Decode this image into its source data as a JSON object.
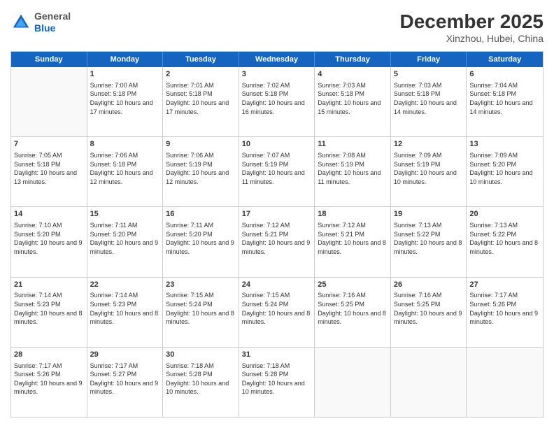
{
  "header": {
    "logo": {
      "general": "General",
      "blue": "Blue"
    },
    "title": "December 2025",
    "location": "Xinzhou, Hubei, China"
  },
  "weekdays": [
    "Sunday",
    "Monday",
    "Tuesday",
    "Wednesday",
    "Thursday",
    "Friday",
    "Saturday"
  ],
  "weeks": [
    [
      {
        "day": "",
        "empty": true
      },
      {
        "day": "1",
        "sunrise": "Sunrise: 7:00 AM",
        "sunset": "Sunset: 5:18 PM",
        "daylight": "Daylight: 10 hours and 17 minutes."
      },
      {
        "day": "2",
        "sunrise": "Sunrise: 7:01 AM",
        "sunset": "Sunset: 5:18 PM",
        "daylight": "Daylight: 10 hours and 17 minutes."
      },
      {
        "day": "3",
        "sunrise": "Sunrise: 7:02 AM",
        "sunset": "Sunset: 5:18 PM",
        "daylight": "Daylight: 10 hours and 16 minutes."
      },
      {
        "day": "4",
        "sunrise": "Sunrise: 7:03 AM",
        "sunset": "Sunset: 5:18 PM",
        "daylight": "Daylight: 10 hours and 15 minutes."
      },
      {
        "day": "5",
        "sunrise": "Sunrise: 7:03 AM",
        "sunset": "Sunset: 5:18 PM",
        "daylight": "Daylight: 10 hours and 14 minutes."
      },
      {
        "day": "6",
        "sunrise": "Sunrise: 7:04 AM",
        "sunset": "Sunset: 5:18 PM",
        "daylight": "Daylight: 10 hours and 14 minutes."
      }
    ],
    [
      {
        "day": "7",
        "sunrise": "Sunrise: 7:05 AM",
        "sunset": "Sunset: 5:18 PM",
        "daylight": "Daylight: 10 hours and 13 minutes."
      },
      {
        "day": "8",
        "sunrise": "Sunrise: 7:06 AM",
        "sunset": "Sunset: 5:18 PM",
        "daylight": "Daylight: 10 hours and 12 minutes."
      },
      {
        "day": "9",
        "sunrise": "Sunrise: 7:06 AM",
        "sunset": "Sunset: 5:19 PM",
        "daylight": "Daylight: 10 hours and 12 minutes."
      },
      {
        "day": "10",
        "sunrise": "Sunrise: 7:07 AM",
        "sunset": "Sunset: 5:19 PM",
        "daylight": "Daylight: 10 hours and 11 minutes."
      },
      {
        "day": "11",
        "sunrise": "Sunrise: 7:08 AM",
        "sunset": "Sunset: 5:19 PM",
        "daylight": "Daylight: 10 hours and 11 minutes."
      },
      {
        "day": "12",
        "sunrise": "Sunrise: 7:09 AM",
        "sunset": "Sunset: 5:19 PM",
        "daylight": "Daylight: 10 hours and 10 minutes."
      },
      {
        "day": "13",
        "sunrise": "Sunrise: 7:09 AM",
        "sunset": "Sunset: 5:20 PM",
        "daylight": "Daylight: 10 hours and 10 minutes."
      }
    ],
    [
      {
        "day": "14",
        "sunrise": "Sunrise: 7:10 AM",
        "sunset": "Sunset: 5:20 PM",
        "daylight": "Daylight: 10 hours and 9 minutes."
      },
      {
        "day": "15",
        "sunrise": "Sunrise: 7:11 AM",
        "sunset": "Sunset: 5:20 PM",
        "daylight": "Daylight: 10 hours and 9 minutes."
      },
      {
        "day": "16",
        "sunrise": "Sunrise: 7:11 AM",
        "sunset": "Sunset: 5:20 PM",
        "daylight": "Daylight: 10 hours and 9 minutes."
      },
      {
        "day": "17",
        "sunrise": "Sunrise: 7:12 AM",
        "sunset": "Sunset: 5:21 PM",
        "daylight": "Daylight: 10 hours and 9 minutes."
      },
      {
        "day": "18",
        "sunrise": "Sunrise: 7:12 AM",
        "sunset": "Sunset: 5:21 PM",
        "daylight": "Daylight: 10 hours and 8 minutes."
      },
      {
        "day": "19",
        "sunrise": "Sunrise: 7:13 AM",
        "sunset": "Sunset: 5:22 PM",
        "daylight": "Daylight: 10 hours and 8 minutes."
      },
      {
        "day": "20",
        "sunrise": "Sunrise: 7:13 AM",
        "sunset": "Sunset: 5:22 PM",
        "daylight": "Daylight: 10 hours and 8 minutes."
      }
    ],
    [
      {
        "day": "21",
        "sunrise": "Sunrise: 7:14 AM",
        "sunset": "Sunset: 5:23 PM",
        "daylight": "Daylight: 10 hours and 8 minutes."
      },
      {
        "day": "22",
        "sunrise": "Sunrise: 7:14 AM",
        "sunset": "Sunset: 5:23 PM",
        "daylight": "Daylight: 10 hours and 8 minutes."
      },
      {
        "day": "23",
        "sunrise": "Sunrise: 7:15 AM",
        "sunset": "Sunset: 5:24 PM",
        "daylight": "Daylight: 10 hours and 8 minutes."
      },
      {
        "day": "24",
        "sunrise": "Sunrise: 7:15 AM",
        "sunset": "Sunset: 5:24 PM",
        "daylight": "Daylight: 10 hours and 8 minutes."
      },
      {
        "day": "25",
        "sunrise": "Sunrise: 7:16 AM",
        "sunset": "Sunset: 5:25 PM",
        "daylight": "Daylight: 10 hours and 8 minutes."
      },
      {
        "day": "26",
        "sunrise": "Sunrise: 7:16 AM",
        "sunset": "Sunset: 5:25 PM",
        "daylight": "Daylight: 10 hours and 9 minutes."
      },
      {
        "day": "27",
        "sunrise": "Sunrise: 7:17 AM",
        "sunset": "Sunset: 5:26 PM",
        "daylight": "Daylight: 10 hours and 9 minutes."
      }
    ],
    [
      {
        "day": "28",
        "sunrise": "Sunrise: 7:17 AM",
        "sunset": "Sunset: 5:26 PM",
        "daylight": "Daylight: 10 hours and 9 minutes."
      },
      {
        "day": "29",
        "sunrise": "Sunrise: 7:17 AM",
        "sunset": "Sunset: 5:27 PM",
        "daylight": "Daylight: 10 hours and 9 minutes."
      },
      {
        "day": "30",
        "sunrise": "Sunrise: 7:18 AM",
        "sunset": "Sunset: 5:28 PM",
        "daylight": "Daylight: 10 hours and 10 minutes."
      },
      {
        "day": "31",
        "sunrise": "Sunrise: 7:18 AM",
        "sunset": "Sunset: 5:28 PM",
        "daylight": "Daylight: 10 hours and 10 minutes."
      },
      {
        "day": "",
        "empty": true
      },
      {
        "day": "",
        "empty": true
      },
      {
        "day": "",
        "empty": true
      }
    ]
  ]
}
